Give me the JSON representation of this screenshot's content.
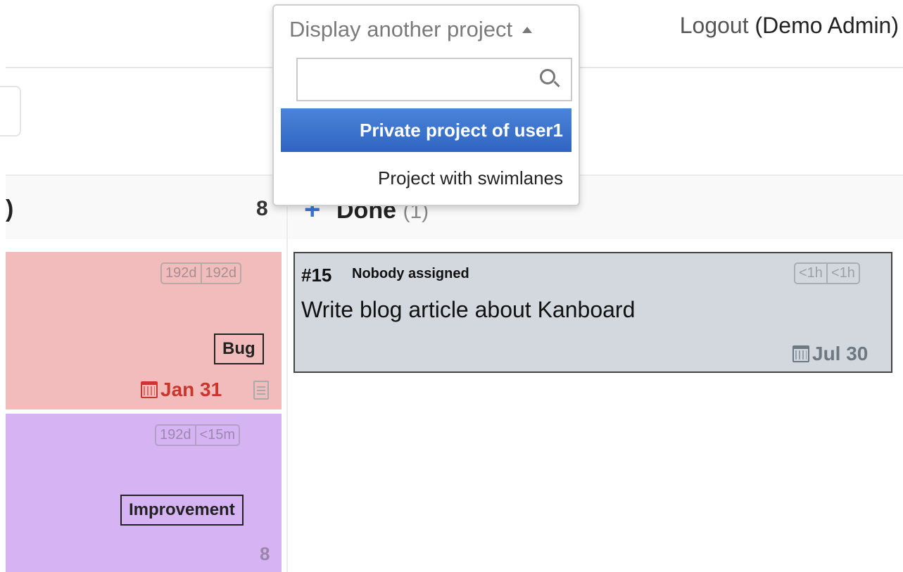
{
  "header": {
    "logout_word": "Logout",
    "user_label": "(Demo Admin)"
  },
  "columns": {
    "left": {
      "title": ")",
      "count": "8"
    },
    "done": {
      "title": "Done",
      "count": "(1)",
      "add_icon": "plus-icon"
    }
  },
  "cards": {
    "red": {
      "time_badges": [
        "192d",
        "192d"
      ],
      "category": "Bug",
      "due": "Jan 31",
      "due_color": "#c8372d",
      "bg_color": "#f3bcbc"
    },
    "purple": {
      "time_badges": [
        "192d",
        "<15m"
      ],
      "category": "Improvement",
      "count": "8",
      "bg_color": "#d6b3f3"
    },
    "done_task": {
      "id": "#15",
      "assignee": "Nobody assigned",
      "title": "Write blog article about Kanboard",
      "time_badges": [
        "<1h",
        "<1h"
      ],
      "due": "Jul 30",
      "bg_color": "#d2d8de"
    }
  },
  "project_switcher": {
    "toggle_label": "Display another project",
    "search_value": "",
    "options": [
      {
        "label": "Private project of user1",
        "selected": true
      },
      {
        "label": "Project with swimlanes",
        "selected": false
      }
    ],
    "accent_color": "#3a74d0"
  }
}
